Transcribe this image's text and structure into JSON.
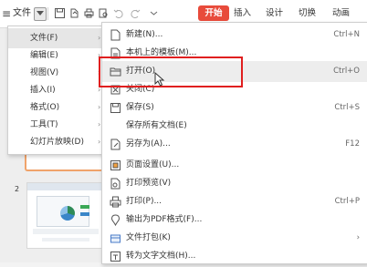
{
  "toolbar": {
    "menu_icon": "≡",
    "file_label": "文件",
    "tabs": [
      {
        "label": "开始",
        "active": true
      },
      {
        "label": "插入"
      },
      {
        "label": "设计"
      },
      {
        "label": "切换"
      },
      {
        "label": "动画"
      }
    ]
  },
  "file_menu": {
    "items": [
      {
        "label": "文件(F)",
        "has_submenu": true,
        "active": true
      },
      {
        "label": "编辑(E)",
        "has_submenu": true
      },
      {
        "label": "视图(V)",
        "has_submenu": true
      },
      {
        "label": "插入(I)",
        "has_submenu": true
      },
      {
        "label": "格式(O)",
        "has_submenu": true
      },
      {
        "label": "工具(T)",
        "has_submenu": true
      },
      {
        "label": "幻灯片放映(D)",
        "has_submenu": true
      }
    ]
  },
  "file_submenu": {
    "items": [
      {
        "icon": "new-document-icon",
        "label": "新建(N)...",
        "shortcut": "Ctrl+N"
      },
      {
        "icon": "template-icon",
        "label": "本机上的模板(M)...",
        "shortcut": ""
      },
      {
        "icon": "folder-open-icon",
        "label": "打开(O)",
        "shortcut": "Ctrl+O",
        "highlighted": true
      },
      {
        "icon": "close-document-icon",
        "label": "关闭(C)",
        "shortcut": ""
      },
      {
        "icon": "save-icon",
        "label": "保存(S)",
        "shortcut": "Ctrl+S"
      },
      {
        "icon": "",
        "label": "保存所有文档(E)",
        "shortcut": ""
      },
      {
        "icon": "save-as-icon",
        "label": "另存为(A)...",
        "shortcut": "F12"
      },
      {
        "icon": "page-setup-icon",
        "label": "页面设置(U)...",
        "shortcut": ""
      },
      {
        "icon": "print-preview-icon",
        "label": "打印预览(V)",
        "shortcut": ""
      },
      {
        "icon": "printer-icon",
        "label": "打印(P)...",
        "shortcut": "Ctrl+P"
      },
      {
        "icon": "export-pdf-icon",
        "label": "输出为PDF格式(F)...",
        "shortcut": ""
      },
      {
        "icon": "package-icon",
        "label": "文件打包(K)",
        "shortcut": "›"
      },
      {
        "icon": "convert-text-icon",
        "label": "转为文字文档(H)...",
        "shortcut": ""
      }
    ]
  },
  "slides": {
    "second_slide_number": "2"
  },
  "colors": {
    "accent": "#e84b3b",
    "highlight_border": "#e01f1f"
  }
}
